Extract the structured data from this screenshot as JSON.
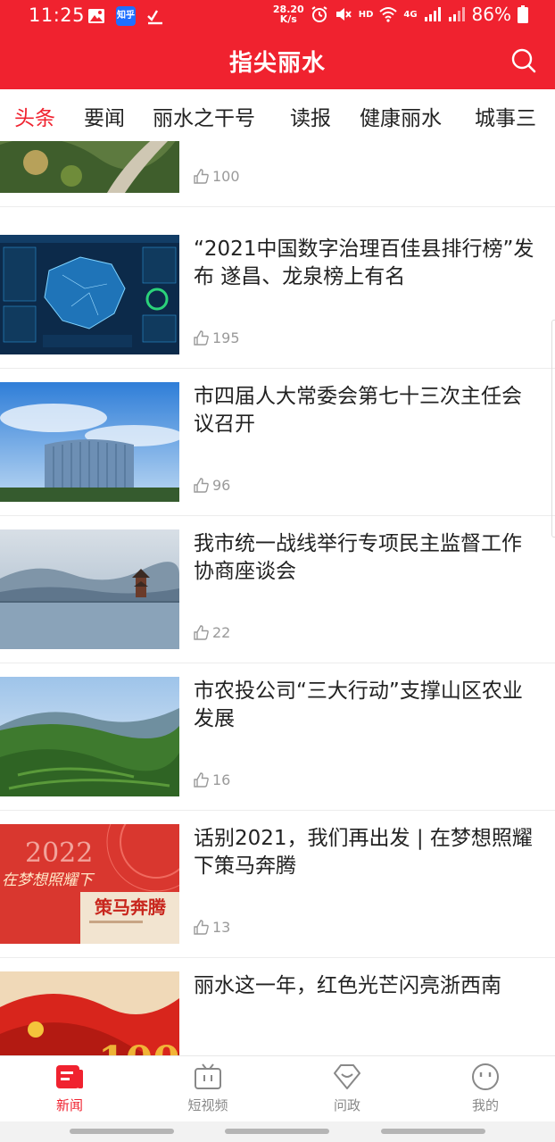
{
  "status_bar": {
    "time": "11:25",
    "zhihu_label": "知乎",
    "speed_value": "28.20",
    "speed_unit": "K/s",
    "hd_label": "HD",
    "net_label": "4G",
    "battery": "86%"
  },
  "header": {
    "title": "指尖丽水"
  },
  "tabs": [
    "头条",
    "要闻",
    "丽水之干号",
    "读报",
    "健康丽水",
    "城事三"
  ],
  "news": [
    {
      "title": "",
      "likes": "100"
    },
    {
      "title": "“2021中国数字治理百佳县排行榜”发布 遂昌、龙泉榜上有名",
      "likes": "195"
    },
    {
      "title": "市四届人大常委会第七十三次主任会议召开",
      "likes": "96"
    },
    {
      "title": "我市统一战线举行专项民主监督工作协商座谈会",
      "likes": "22"
    },
    {
      "title": "市农投公司“三大行动”支撑山区农业发展",
      "likes": "16"
    },
    {
      "title": "话别2021，我们再出发 | 在梦想照耀下策马奔腾",
      "likes": "13"
    },
    {
      "title": "丽水这一年，红色光芒闪亮浙西南",
      "likes": ""
    }
  ],
  "thumb_text": {
    "dashboard_heading": "",
    "year": "2022",
    "dream": "在梦想照耀下",
    "horse": "策马奔腾"
  },
  "bottom_nav": [
    {
      "label": "新闻",
      "icon": "news-icon"
    },
    {
      "label": "短视频",
      "icon": "tv-icon"
    },
    {
      "label": "问政",
      "icon": "chat-heart-icon"
    },
    {
      "label": "我的",
      "icon": "smile-icon"
    }
  ],
  "colors": {
    "brand_red": "#f0222f",
    "muted": "#9a9a9a",
    "text": "#222222"
  }
}
